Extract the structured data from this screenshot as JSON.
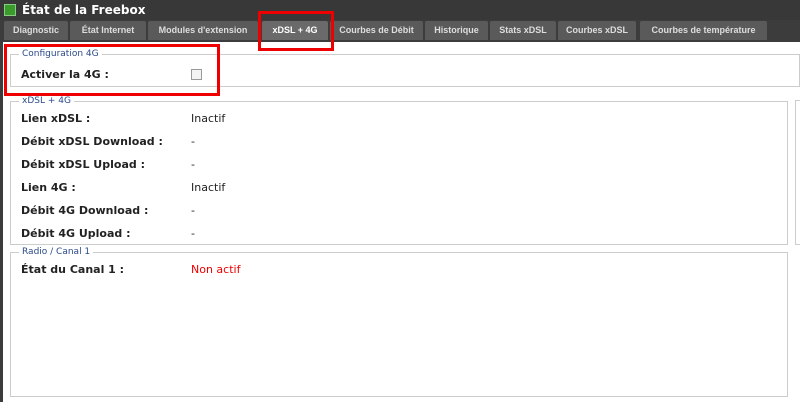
{
  "window": {
    "title": "État de la Freebox"
  },
  "tabs": [
    "Diagnostic",
    "État Internet",
    "Modules d'extension",
    "xDSL + 4G",
    "Courbes de Débit",
    "Historique",
    "Stats xDSL",
    "Courbes xDSL",
    "Courbes de température"
  ],
  "config4g": {
    "legend": "Configuration 4G",
    "label": "Activer la 4G :"
  },
  "xdsl": {
    "legend": "xDSL + 4G",
    "rows": [
      {
        "label": "Lien xDSL :",
        "value": "Inactif"
      },
      {
        "label": "Débit xDSL Download :",
        "value": "-"
      },
      {
        "label": "Débit xDSL Upload :",
        "value": "-"
      },
      {
        "label": "Lien 4G :",
        "value": "Inactif"
      },
      {
        "label": "Débit 4G Download :",
        "value": "-"
      },
      {
        "label": "Débit 4G Upload :",
        "value": "-"
      }
    ]
  },
  "radio": {
    "legend": "Radio / Canal 1",
    "label": "État du Canal 1 :",
    "value": "Non actif",
    "value_color": "#e00000"
  }
}
